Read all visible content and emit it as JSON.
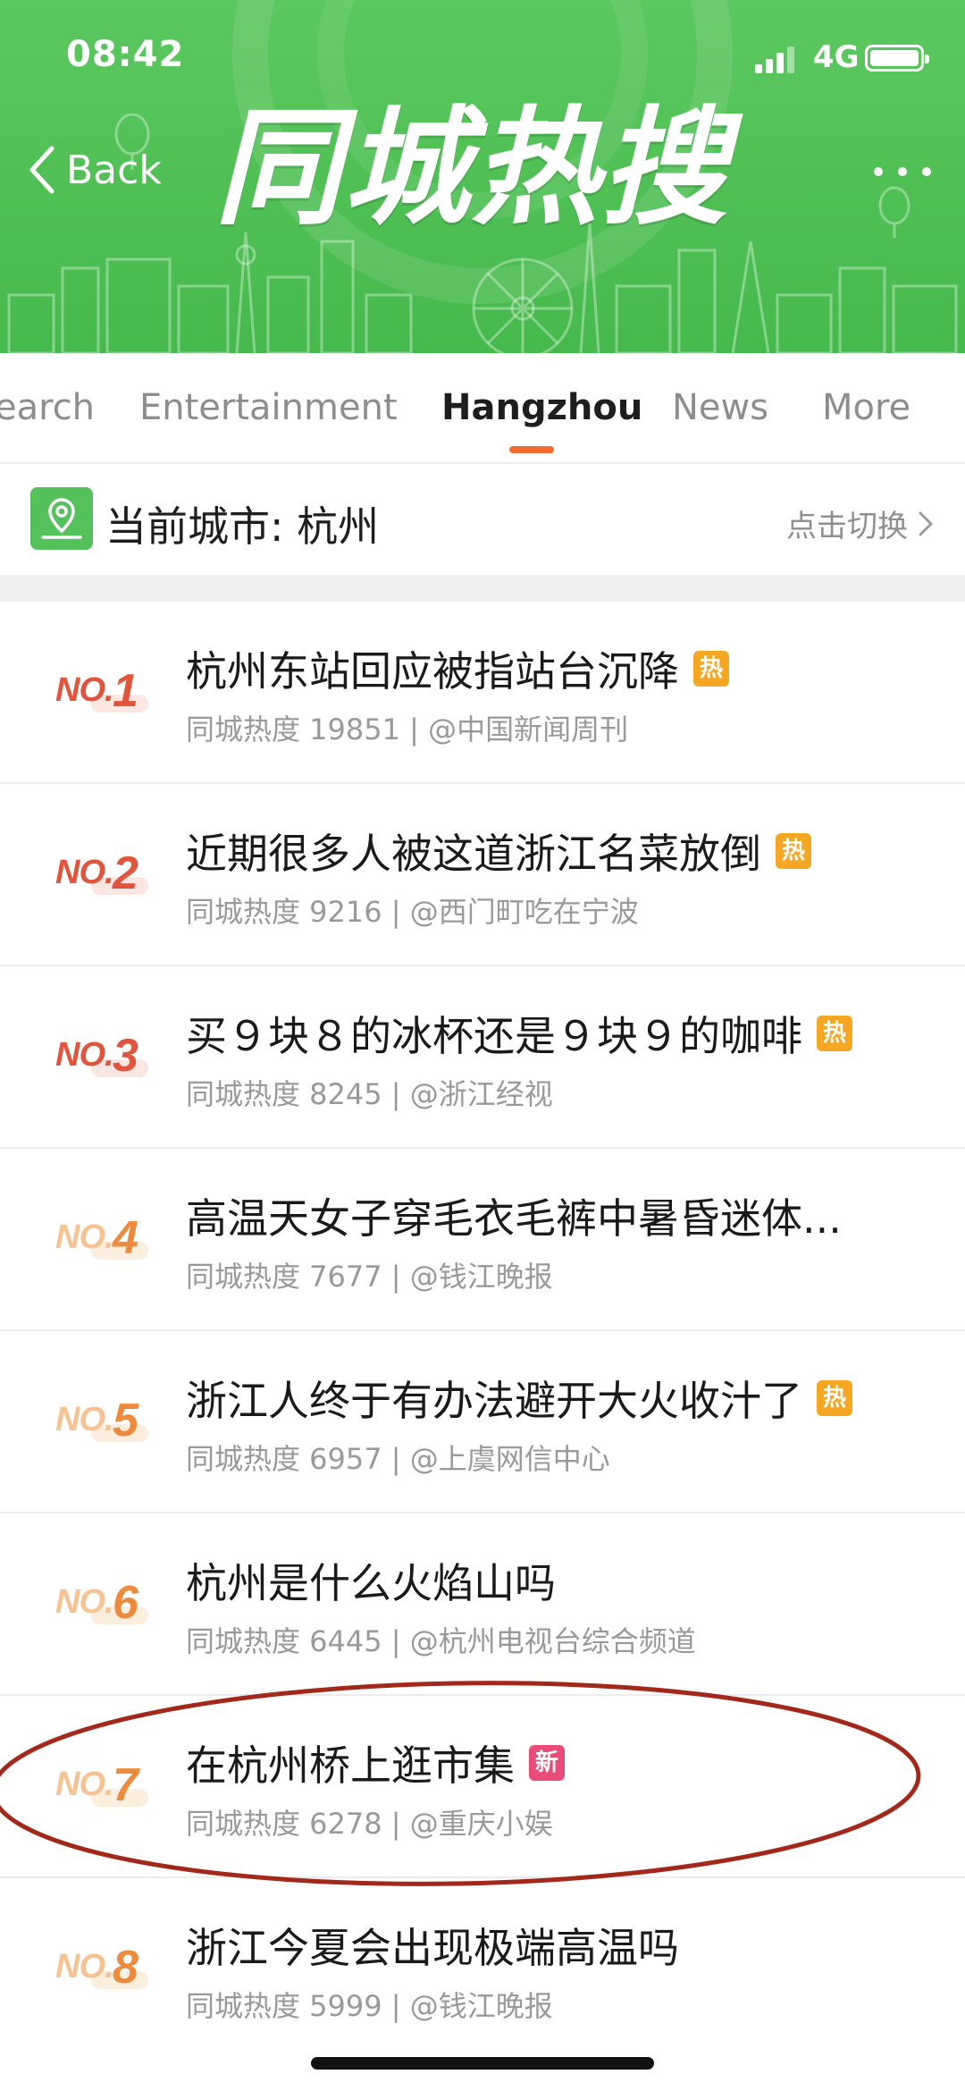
{
  "status_bar": {
    "time": "08:42",
    "network": "4G"
  },
  "header": {
    "back_label": "Back",
    "banner_title": "同城热搜"
  },
  "tabs": [
    {
      "label": "earch",
      "active": false
    },
    {
      "label": "Entertainment",
      "active": false
    },
    {
      "label": "Hangzhou",
      "active": true
    },
    {
      "label": "News",
      "active": false
    },
    {
      "label": "More",
      "active": false
    }
  ],
  "city_bar": {
    "label": "当前城市: 杭州",
    "switch_label": "点击切换"
  },
  "colors": {
    "brand_green": "#4cbd52",
    "accent_orange": "#f26b2e",
    "hot_badge": "#f5a623",
    "new_badge": "#ea4c79"
  },
  "list": [
    {
      "no": "NO.",
      "num": "1",
      "title": "杭州东站回应被指站台沉降",
      "badge": "热",
      "meta": "同城热度 19851 | @中国新闻周刊"
    },
    {
      "no": "NO.",
      "num": "2",
      "title": "近期很多人被这道浙江名菜放倒",
      "badge": "热",
      "meta": "同城热度 9216 | @西门町吃在宁波"
    },
    {
      "no": "NO.",
      "num": "3",
      "title": "买９块８的冰杯还是９块９的咖啡",
      "badge": "热",
      "meta": "同城热度 8245 | @浙江经视"
    },
    {
      "no": "NO.",
      "num": "4",
      "title": "高温天女子穿毛衣毛裤中暑昏迷体...",
      "badge": "",
      "meta": "同城热度 7677 | @钱江晚报"
    },
    {
      "no": "NO.",
      "num": "5",
      "title": "浙江人终于有办法避开大火收汁了",
      "badge": "热",
      "meta": "同城热度 6957 | @上虞网信中心"
    },
    {
      "no": "NO.",
      "num": "6",
      "title": "杭州是什么火焰山吗",
      "badge": "",
      "meta": "同城热度 6445 | @杭州电视台综合频道"
    },
    {
      "no": "NO.",
      "num": "7",
      "title": "在杭州桥上逛市集",
      "badge": "新",
      "meta": "同城热度 6278 | @重庆小娱"
    },
    {
      "no": "NO.",
      "num": "8",
      "title": "浙江今夏会出现极端高温吗",
      "badge": "",
      "meta": "同城热度 5999 | @钱江晚报"
    }
  ]
}
